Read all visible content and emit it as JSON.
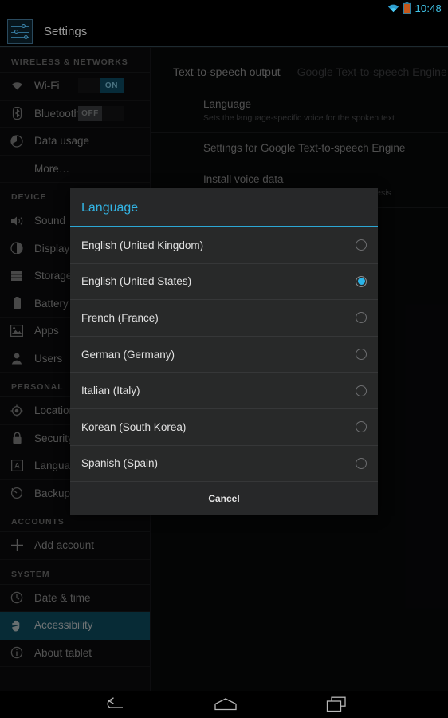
{
  "status_bar": {
    "time": "10:48",
    "wifi_icon": "wifi-icon",
    "battery_icon": "battery-icon",
    "accent": "#40c4e8"
  },
  "action_bar": {
    "title": "Settings",
    "icon": "settings-sliders-icon"
  },
  "sidebar": {
    "groups": [
      {
        "header": "WIRELESS & NETWORKS",
        "items": [
          {
            "label": "Wi-Fi",
            "icon": "wifi-icon",
            "toggle": "ON",
            "toggle_state": "on"
          },
          {
            "label": "Bluetooth",
            "icon": "bluetooth-icon",
            "toggle": "OFF",
            "toggle_state": "off"
          },
          {
            "label": "Data usage",
            "icon": "data-usage-icon"
          },
          {
            "label": "More…",
            "icon": null
          }
        ]
      },
      {
        "header": "DEVICE",
        "items": [
          {
            "label": "Sound",
            "icon": "sound-icon"
          },
          {
            "label": "Display",
            "icon": "display-icon"
          },
          {
            "label": "Storage",
            "icon": "storage-icon"
          },
          {
            "label": "Battery",
            "icon": "battery-icon"
          },
          {
            "label": "Apps",
            "icon": "apps-icon"
          },
          {
            "label": "Users",
            "icon": "users-icon"
          }
        ]
      },
      {
        "header": "PERSONAL",
        "items": [
          {
            "label": "Location a",
            "icon": "location-icon"
          },
          {
            "label": "Security",
            "icon": "lock-icon"
          },
          {
            "label": "Language",
            "icon": "language-icon"
          },
          {
            "label": "Backup & r",
            "icon": "backup-icon"
          }
        ]
      },
      {
        "header": "ACCOUNTS",
        "items": [
          {
            "label": "Add account",
            "icon": "plus-icon"
          }
        ]
      },
      {
        "header": "SYSTEM",
        "items": [
          {
            "label": "Date & time",
            "icon": "clock-icon"
          },
          {
            "label": "Accessibility",
            "icon": "accessibility-hand-icon",
            "selected": true
          },
          {
            "label": "About tablet",
            "icon": "info-icon"
          }
        ]
      }
    ],
    "selected_color": "#0d4a5e"
  },
  "content": {
    "header_title": "Text-to-speech output",
    "header_engine": "Google Text-to-speech Engine",
    "rows": [
      {
        "title": "Language",
        "subtitle": "Sets the language-specific voice for the spoken text"
      },
      {
        "title": "Settings for Google Text-to-speech Engine",
        "subtitle": ""
      },
      {
        "title": "Install voice data",
        "subtitle": "Install the voice data required for speech synthesis"
      }
    ]
  },
  "dialog": {
    "title": "Language",
    "title_color": "#33b5e5",
    "options": [
      {
        "label": "English (United Kingdom)",
        "selected": false
      },
      {
        "label": "English (United States)",
        "selected": true
      },
      {
        "label": "French (France)",
        "selected": false
      },
      {
        "label": "German (Germany)",
        "selected": false
      },
      {
        "label": "Italian (Italy)",
        "selected": false
      },
      {
        "label": "Korean (South Korea)",
        "selected": false
      },
      {
        "label": "Spanish (Spain)",
        "selected": false
      }
    ],
    "cancel_label": "Cancel"
  },
  "nav_bar": {
    "back": "back-icon",
    "home": "home-icon",
    "recents": "recents-icon"
  }
}
